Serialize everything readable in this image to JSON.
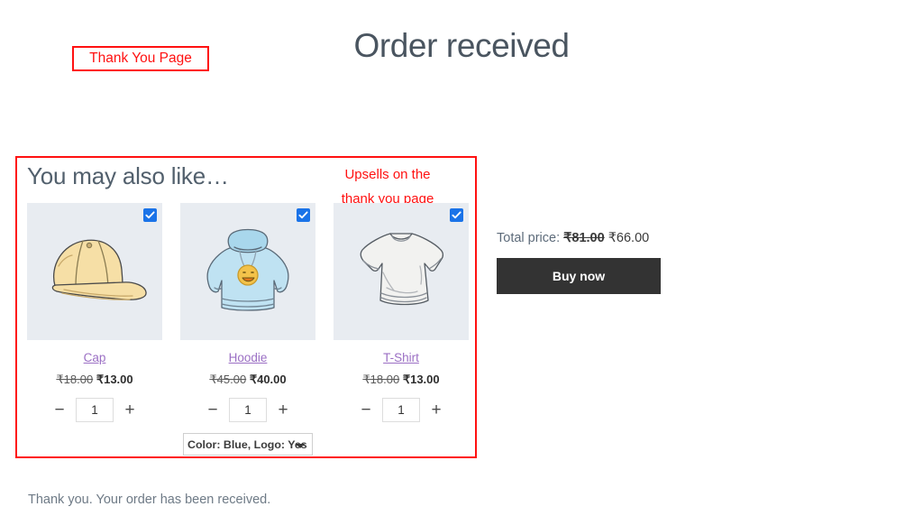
{
  "page": {
    "title": "Order received",
    "received_note": "Thank you. Your order has been received."
  },
  "annotations": {
    "thank_you_page": "Thank You Page",
    "upsells_note": "Upsells on the\nthank you page",
    "color": "#ff1111"
  },
  "upsell": {
    "heading": "You may also like…",
    "currency": "₹",
    "products": [
      {
        "name": "Cap",
        "icon": "cap-image",
        "old_price": "₹18.00",
        "new_price": "₹13.00",
        "quantity": "1",
        "selected": true,
        "minus_label": "−",
        "plus_label": "+"
      },
      {
        "name": "Hoodie",
        "icon": "hoodie-image",
        "old_price": "₹45.00",
        "new_price": "₹40.00",
        "quantity": "1",
        "selected": true,
        "minus_label": "−",
        "plus_label": "+",
        "variant": "Color: Blue, Logo: Yes"
      },
      {
        "name": "T-Shirt",
        "icon": "tshirt-image",
        "old_price": "₹18.00",
        "new_price": "₹13.00",
        "quantity": "1",
        "selected": true,
        "minus_label": "−",
        "plus_label": "+"
      }
    ]
  },
  "checkout": {
    "total_label": "Total price:",
    "total_old": "₹81.00",
    "total_new": "₹66.00",
    "buy_label": "Buy now",
    "button_color": "#333333"
  }
}
